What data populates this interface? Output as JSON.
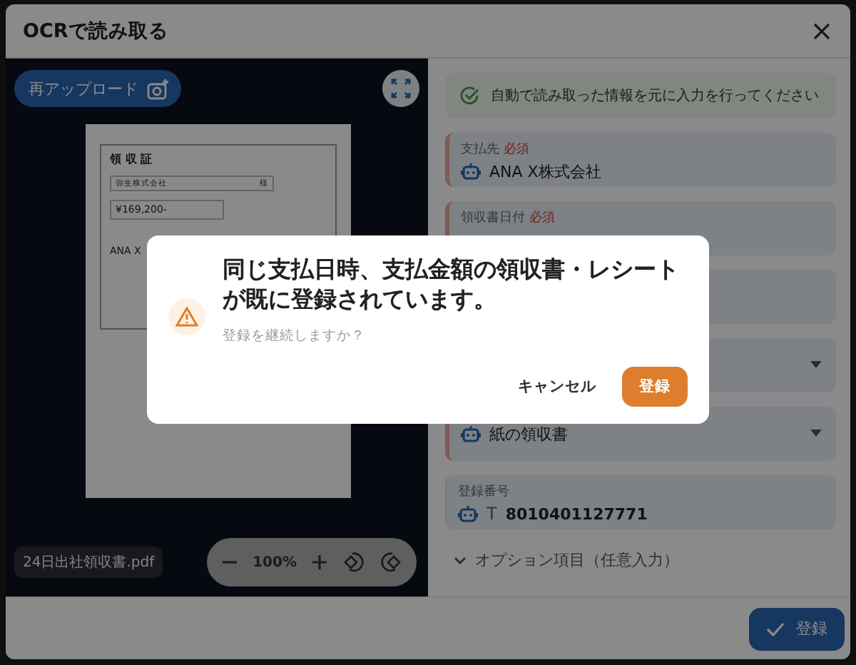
{
  "window": {
    "title": "OCRで読み取る"
  },
  "viewer": {
    "reupload_label": "再アップロード",
    "document": {
      "heading": "領 収 証",
      "recipient": "弥生株式会社",
      "honorific": "様",
      "amount": "¥169,200-",
      "issuer": "ANA X"
    },
    "file_name": "24日出社領収書.pdf",
    "zoom": "100%"
  },
  "notice": "自動で読み取った情報を元に入力を行ってください",
  "fields": [
    {
      "kind": "text",
      "label": "支払先",
      "required_mark": "必須",
      "required": true,
      "auto": true,
      "value": "ANA X株式会社"
    },
    {
      "kind": "text",
      "label": "領収書日付",
      "required_mark": "必須",
      "required": true
    },
    {
      "kind": "text"
    },
    {
      "kind": "select"
    },
    {
      "kind": "select",
      "required": true,
      "auto": true,
      "value": "紙の領収書"
    },
    {
      "kind": "text",
      "label": "登録番号",
      "required": false,
      "auto": true,
      "prefix": "T",
      "value": "8010401127771"
    }
  ],
  "options_toggle": "オプション項目（任意入力）",
  "submit_label": "登録",
  "confirm": {
    "title": "同じ支払日時、支払金額の領収書・レシートが既に登録されています。",
    "message": "登録を継続しますか？",
    "cancel_label": "キャンセル",
    "confirm_label": "登録"
  }
}
